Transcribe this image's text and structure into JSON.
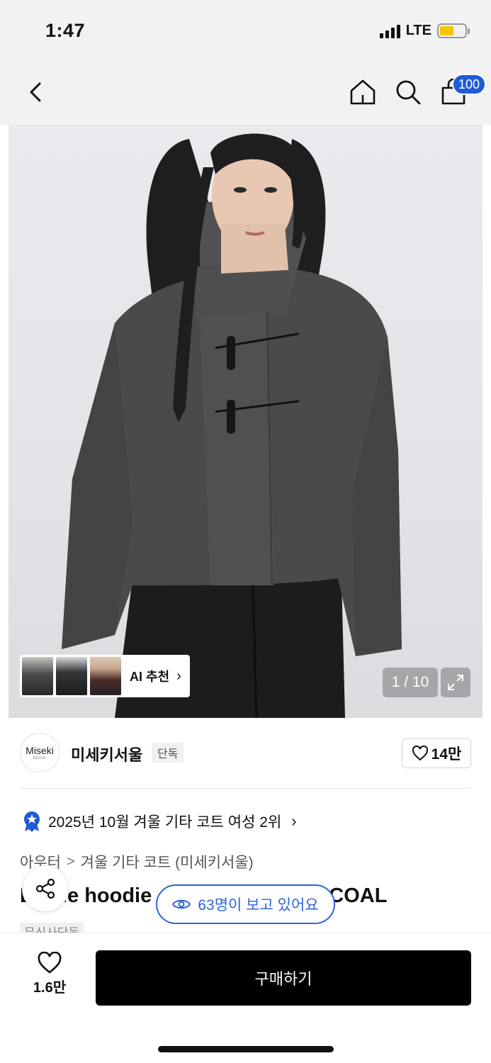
{
  "status_bar": {
    "time": "1:47",
    "network": "LTE",
    "battery_color": "#f6c700"
  },
  "nav": {
    "cart_count": "100",
    "icons": [
      "back-icon",
      "home-icon",
      "search-icon",
      "cart-icon"
    ]
  },
  "gallery": {
    "counter": "1 / 10",
    "ai_label": "AI 추천",
    "progress_current": 1,
    "progress_total": 10
  },
  "brand": {
    "logo_text": "Miseki",
    "logo_sub": "SEOUL",
    "name": "미세키서울",
    "tag": "단독",
    "likes": "14만"
  },
  "ranking": {
    "text": "2025년 10월 겨울 기타 코트 여성 2위"
  },
  "breadcrumb": {
    "level1": "아우터",
    "separator": ">",
    "level2": "겨울 기타 코트 (미세키서울)"
  },
  "product": {
    "title_left": "D",
    "title_mid": "le hoodie",
    "title_right": "COAL",
    "badge": "무신사단독"
  },
  "viewers": {
    "text": "63명이 보고 있어요"
  },
  "bottom": {
    "like_count": "1.6만",
    "buy_label": "구매하기"
  },
  "colors": {
    "accent": "#2d64dc",
    "badge_blue": "#1f5bd6",
    "buy_bg": "#000000"
  }
}
